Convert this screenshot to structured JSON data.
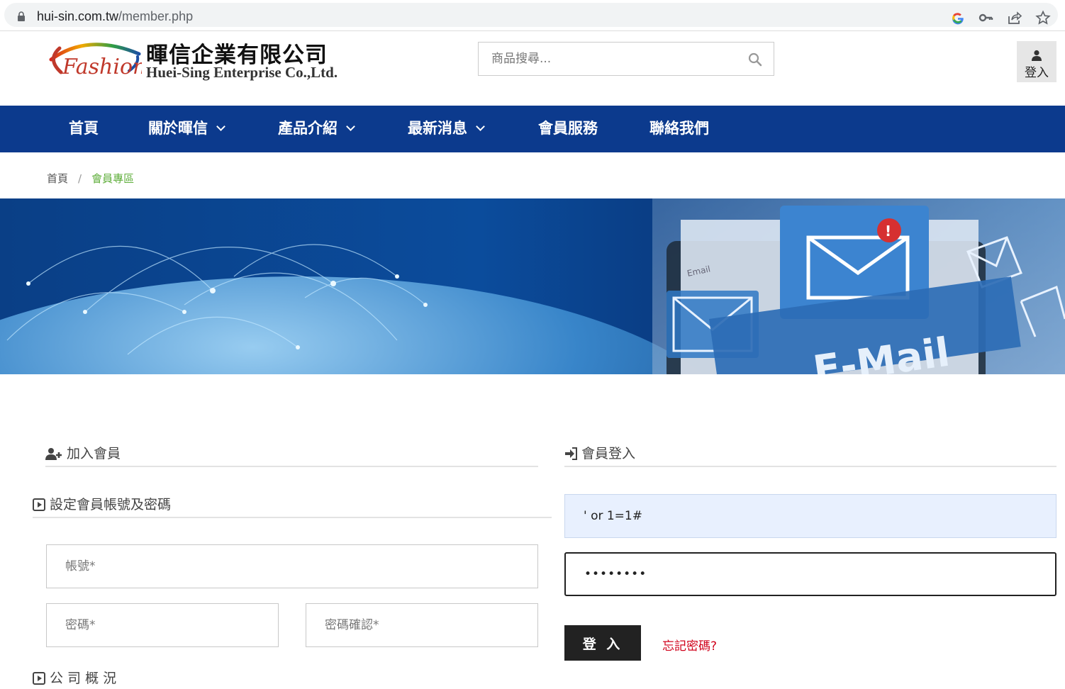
{
  "browser": {
    "url_host": "hui-sin.com.tw",
    "url_path": "/member.php",
    "icons": [
      "lock-icon",
      "google-icon",
      "key-icon",
      "share-icon",
      "star-icon"
    ]
  },
  "header": {
    "logo_text": "Fashion",
    "company_cn": "暉信企業有限公司",
    "company_en": "Huei-Sing Enterprise Co.,Ltd.",
    "search_placeholder": "商品搜尋...",
    "login_label": "登入"
  },
  "nav": {
    "items": [
      {
        "label": "首頁",
        "dropdown": false
      },
      {
        "label": "關於暉信",
        "dropdown": true
      },
      {
        "label": "產品介紹",
        "dropdown": true
      },
      {
        "label": "最新消息",
        "dropdown": true
      },
      {
        "label": "會員服務",
        "dropdown": false
      },
      {
        "label": "聯絡我們",
        "dropdown": false
      }
    ],
    "bg_color": "#0c3a8d"
  },
  "breadcrumb": {
    "home": "首頁",
    "separator": "/",
    "current": "會員專區"
  },
  "banner": {
    "mail_text": "E-Mail",
    "email_label": "Email"
  },
  "register": {
    "title": "加入會員",
    "subtitle": "設定會員帳號及密碼",
    "account_placeholder": "帳號*",
    "password_placeholder": "密碼*",
    "confirm_placeholder": "密碼確認*",
    "company_section": "公 司 概 況"
  },
  "login": {
    "title": "會員登入",
    "username_value": "' or 1=1#",
    "password_value": "••••••••",
    "button_label": "登 入",
    "forgot_label": "忘記密碼?"
  }
}
